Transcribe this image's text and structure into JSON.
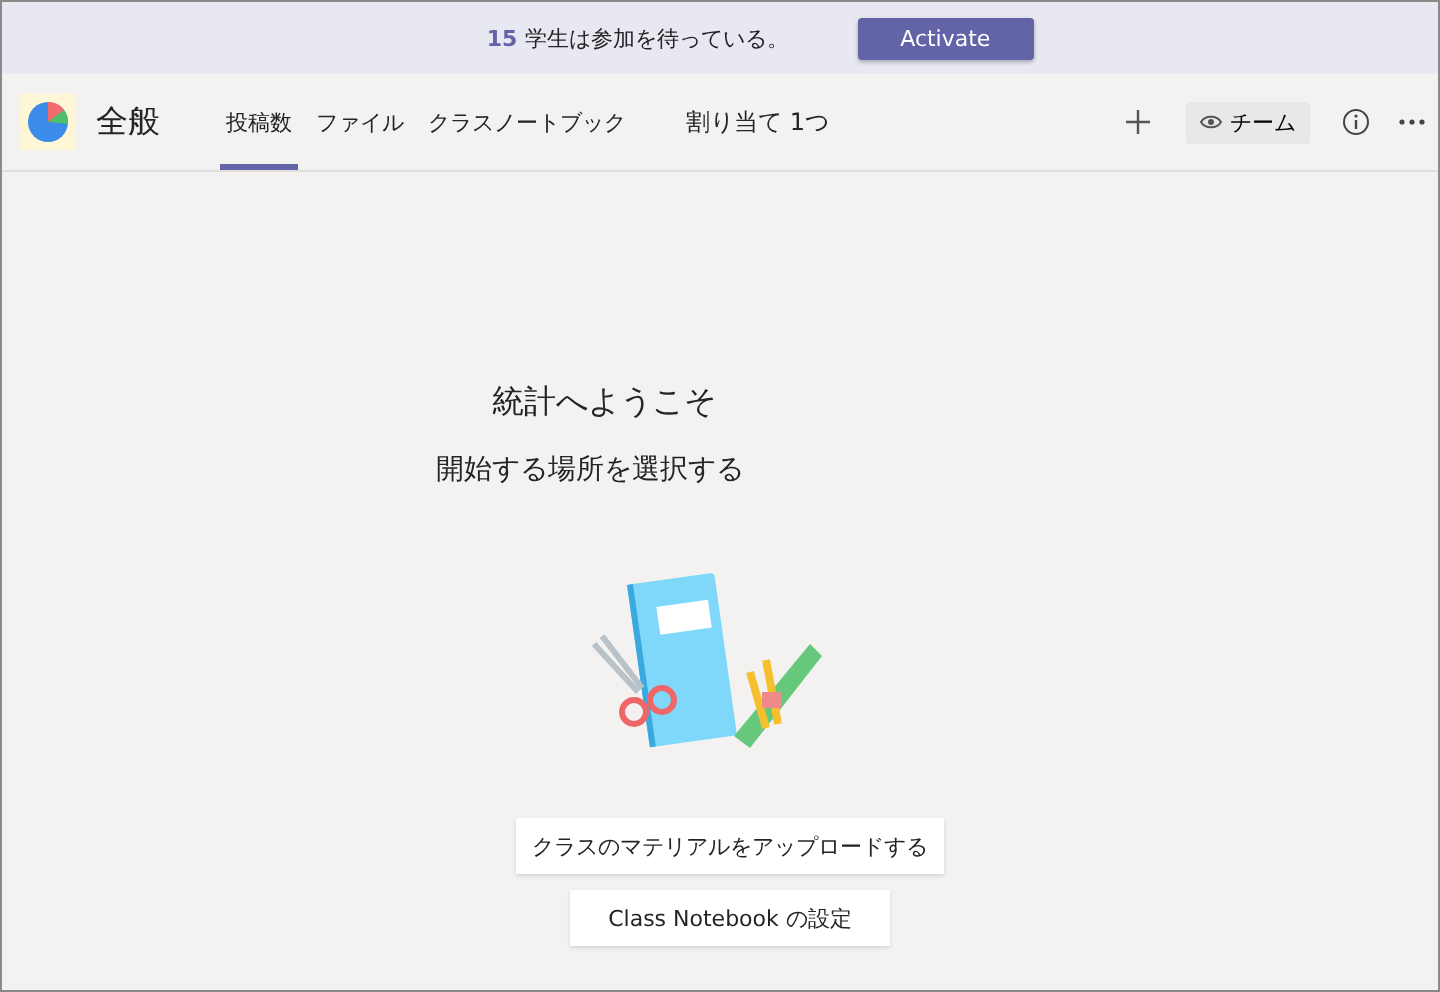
{
  "banner": {
    "count": "15",
    "message": "学生は参加を待っている。",
    "button": "Activate"
  },
  "header": {
    "team_name": "全般",
    "tabs": [
      {
        "label": "投稿数",
        "selected": true
      },
      {
        "label": "ファイル",
        "selected": false
      },
      {
        "label": "クラスノートブック",
        "selected": false
      },
      {
        "label": "割り当て 1つ",
        "selected": false
      }
    ],
    "view_button": "チーム"
  },
  "main": {
    "title": "統計へようこそ",
    "subtitle": "開始する場所を選択する",
    "actions": [
      "クラスのマテリアルをアップロードする",
      "Class Notebook の設定"
    ]
  }
}
